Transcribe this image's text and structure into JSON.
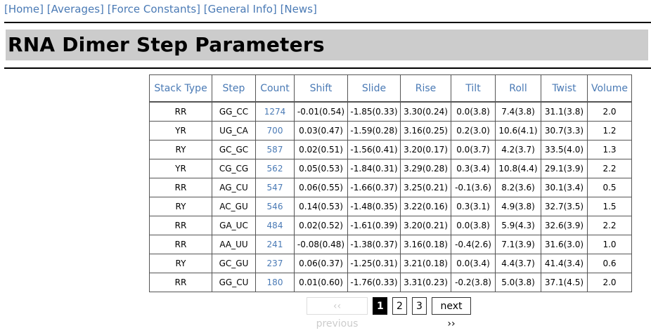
{
  "nav": {
    "items": [
      "[Home]",
      "[Averages]",
      "[Force Constants]",
      "[General Info]",
      "[News]"
    ]
  },
  "page": {
    "title": "RNA Dimer Step Parameters"
  },
  "table": {
    "headers": [
      "Stack Type",
      "Step",
      "Count",
      "Shift",
      "Slide",
      "Rise",
      "Tilt",
      "Roll",
      "Twist",
      "Volume"
    ],
    "rows": [
      [
        "RR",
        "GG_CC",
        "1274",
        "-0.01(0.54)",
        "-1.85(0.33)",
        "3.30(0.24)",
        "0.0(3.8)",
        "7.4(3.8)",
        "31.1(3.8)",
        "2.0"
      ],
      [
        "YR",
        "UG_CA",
        "700",
        "0.03(0.47)",
        "-1.59(0.28)",
        "3.16(0.25)",
        "0.2(3.0)",
        "10.6(4.1)",
        "30.7(3.3)",
        "1.2"
      ],
      [
        "RY",
        "GC_GC",
        "587",
        "0.02(0.51)",
        "-1.56(0.41)",
        "3.20(0.17)",
        "0.0(3.7)",
        "4.2(3.7)",
        "33.5(4.0)",
        "1.3"
      ],
      [
        "YR",
        "CG_CG",
        "562",
        "0.05(0.53)",
        "-1.84(0.31)",
        "3.29(0.28)",
        "0.3(3.4)",
        "10.8(4.4)",
        "29.1(3.9)",
        "2.2"
      ],
      [
        "RR",
        "AG_CU",
        "547",
        "0.06(0.55)",
        "-1.66(0.37)",
        "3.25(0.21)",
        "-0.1(3.6)",
        "8.2(3.6)",
        "30.1(3.4)",
        "0.5"
      ],
      [
        "RY",
        "AC_GU",
        "546",
        "0.14(0.53)",
        "-1.48(0.35)",
        "3.22(0.16)",
        "0.3(3.1)",
        "4.9(3.8)",
        "32.7(3.5)",
        "1.5"
      ],
      [
        "RR",
        "GA_UC",
        "484",
        "0.02(0.52)",
        "-1.61(0.39)",
        "3.20(0.21)",
        "0.0(3.8)",
        "5.9(4.3)",
        "32.6(3.9)",
        "2.2"
      ],
      [
        "RR",
        "AA_UU",
        "241",
        "-0.08(0.48)",
        "-1.38(0.37)",
        "3.16(0.18)",
        "-0.4(2.6)",
        "7.1(3.9)",
        "31.6(3.0)",
        "1.0"
      ],
      [
        "RY",
        "GC_GU",
        "237",
        "0.06(0.37)",
        "-1.25(0.31)",
        "3.21(0.18)",
        "0.0(3.4)",
        "4.4(3.7)",
        "41.4(3.4)",
        "0.6"
      ],
      [
        "RR",
        "GG_CU",
        "180",
        "0.01(0.60)",
        "-1.76(0.33)",
        "3.31(0.23)",
        "-0.2(3.8)",
        "5.0(3.8)",
        "37.1(4.5)",
        "2.0"
      ]
    ]
  },
  "pagination": {
    "previous": "‹‹ previous",
    "pages": [
      "1",
      "2",
      "3"
    ],
    "current": "1",
    "next": "next ››"
  },
  "colors": {
    "link": "#4a7ab5",
    "title_bg": "#cccccc"
  }
}
